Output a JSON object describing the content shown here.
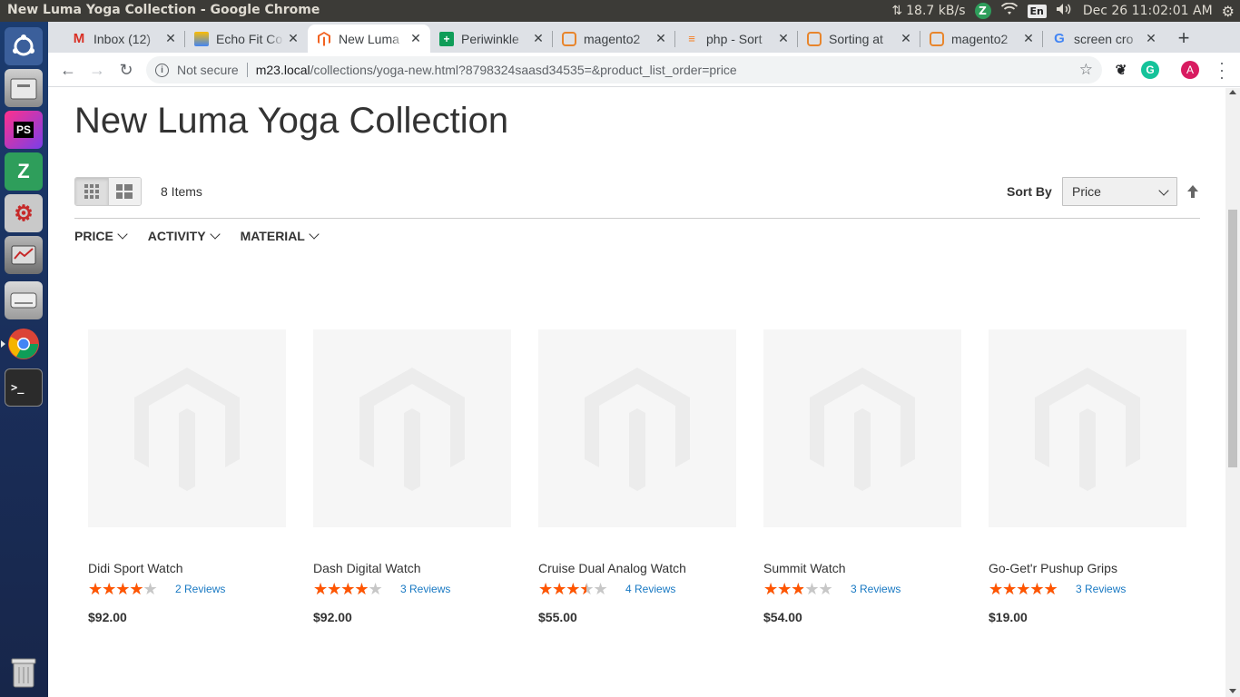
{
  "os": {
    "window_title": "New Luma Yoga Collection - Google Chrome",
    "net_speed": "18.7 kB/s",
    "keyboard_layout": "En",
    "clock": "Dec 26 11:02:01 AM"
  },
  "launcher": {
    "apps": [
      {
        "name": "ubuntu-dash-icon",
        "label": ""
      },
      {
        "name": "files-icon",
        "label": ""
      },
      {
        "name": "phpstorm-icon",
        "label": "PS"
      },
      {
        "name": "zoom-icon",
        "label": "Z"
      },
      {
        "name": "system-settings-icon",
        "label": ""
      },
      {
        "name": "system-monitor-icon",
        "label": ""
      },
      {
        "name": "drive-icon",
        "label": ""
      },
      {
        "name": "chrome-icon",
        "label": ""
      },
      {
        "name": "terminal-icon",
        "label": ">_"
      },
      {
        "name": "trash-icon",
        "label": ""
      }
    ]
  },
  "browser": {
    "tabs": [
      {
        "title": "Inbox (12)",
        "favicon": "gmail-icon",
        "color": "#d93025"
      },
      {
        "title": "Echo Fit Co",
        "favicon": "echo-fit-icon",
        "color": "#4285f4"
      },
      {
        "title": "New Luma",
        "favicon": "magento-icon",
        "color": "#f26322",
        "active": true
      },
      {
        "title": "Periwinkle",
        "favicon": "sheets-icon",
        "color": "#0f9d58"
      },
      {
        "title": "magento2",
        "favicon": "magento-se-icon",
        "color": "#e8852c"
      },
      {
        "title": "php - Sort",
        "favicon": "stackoverflow-icon",
        "color": "#f48024"
      },
      {
        "title": "Sorting at",
        "favicon": "magento-se-icon",
        "color": "#e8852c"
      },
      {
        "title": "magento2",
        "favicon": "magento-se-icon",
        "color": "#e8852c"
      },
      {
        "title": "screen cro",
        "favicon": "google-icon",
        "color": "#4285f4"
      }
    ],
    "security_label": "Not secure",
    "url_host": "m23.local",
    "url_path": "/collections/yoga-new.html?8798324saasd34535=&product_list_order=price",
    "profile_initial": "A"
  },
  "page": {
    "title": "New Luma Yoga Collection",
    "item_count": "8 Items",
    "sort_label": "Sort By",
    "sort_value": "Price",
    "filters": [
      "PRICE",
      "ACTIVITY",
      "MATERIAL"
    ],
    "accent_color": "#ff5501",
    "link_color": "#1979c3"
  },
  "products": [
    {
      "name": "Didi Sport Watch",
      "rating": 3.5,
      "reviews": "2 Reviews",
      "price": "$92.00"
    },
    {
      "name": "Dash Digital Watch",
      "rating": 3.5,
      "reviews": "3 Reviews",
      "price": "$92.00"
    },
    {
      "name": "Cruise Dual Analog Watch",
      "rating": 3,
      "reviews": "4 Reviews",
      "price": "$55.00"
    },
    {
      "name": "Summit Watch",
      "rating": 2.5,
      "reviews": "3 Reviews",
      "price": "$54.00"
    },
    {
      "name": "Go-Get'r Pushup Grips",
      "rating": 4.5,
      "reviews": "3 Reviews",
      "price": "$19.00"
    }
  ]
}
